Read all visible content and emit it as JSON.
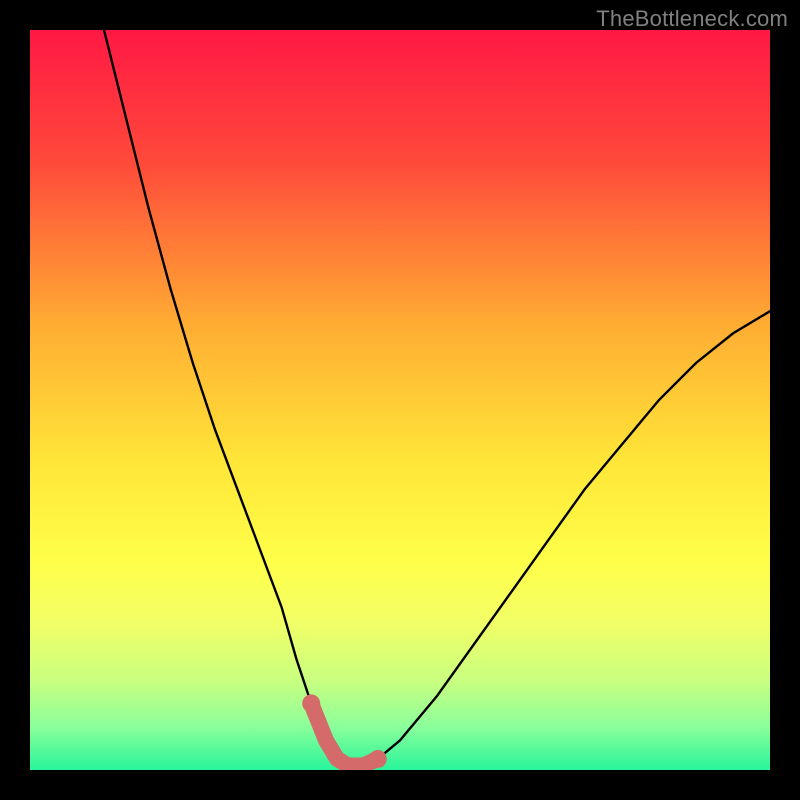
{
  "attribution": "TheBottleneck.com",
  "chart_data": {
    "type": "line",
    "title": "",
    "xlabel": "",
    "ylabel": "",
    "xlim": [
      0,
      100
    ],
    "ylim": [
      0,
      100
    ],
    "gradient_stops": [
      {
        "pct": 0,
        "color": "#ff1844"
      },
      {
        "pct": 18,
        "color": "#ff4a3a"
      },
      {
        "pct": 40,
        "color": "#ffad33"
      },
      {
        "pct": 58,
        "color": "#ffe538"
      },
      {
        "pct": 72,
        "color": "#ffff4a"
      },
      {
        "pct": 80,
        "color": "#f2ff66"
      },
      {
        "pct": 88,
        "color": "#c8ff80"
      },
      {
        "pct": 94,
        "color": "#8cff9a"
      },
      {
        "pct": 100,
        "color": "#29f59b"
      }
    ],
    "series": [
      {
        "name": "bottleneck-curve",
        "x": [
          10,
          13,
          16,
          19,
          22,
          25,
          28,
          31,
          34,
          36,
          38,
          40,
          41.5,
          43,
          45,
          47,
          50,
          55,
          60,
          65,
          70,
          75,
          80,
          85,
          90,
          95,
          100
        ],
        "y": [
          100,
          88,
          76,
          65,
          55,
          46,
          38,
          30,
          22,
          15,
          9,
          4,
          1.5,
          0.6,
          0.6,
          1.5,
          4,
          10,
          17,
          24,
          31,
          38,
          44,
          50,
          55,
          59,
          62
        ]
      }
    ],
    "highlight_segment": {
      "name": "optimal-range",
      "color": "#d46a6a",
      "x": [
        38,
        40,
        41.5,
        43,
        45,
        47
      ],
      "y": [
        9,
        4,
        1.5,
        0.6,
        0.6,
        1.5
      ]
    }
  }
}
